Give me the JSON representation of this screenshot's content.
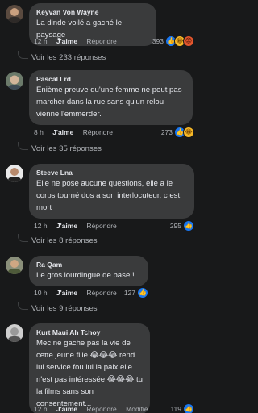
{
  "comments": [
    {
      "author": "Keyvan Von Wayne",
      "text": "La dinde voilé a gaché le paysage",
      "time": "12 h",
      "like": "J'aime",
      "reply": "Répondre",
      "reaction_count": "393",
      "replies": "Voir les 233 réponses"
    },
    {
      "author": "Pascal Lrd",
      "text": "Enième preuve qu'une femme ne peut pas marcher dans la rue sans qu'un relou vienne l'emmerder.",
      "time": "8 h",
      "like": "J'aime",
      "reply": "Répondre",
      "reaction_count": "273",
      "replies": "Voir les 35 réponses"
    },
    {
      "author": "Steeve Lna",
      "text": "Elle ne pose aucune questions, elle a le corps tourné dos a son interlocuteur, c est mort",
      "time": "12 h",
      "like": "J'aime",
      "reply": "Répondre",
      "reaction_count": "295",
      "replies": "Voir les 8 réponses"
    },
    {
      "author": "Ra Qam",
      "text": "Le gros lourdingue de base !",
      "time": "10 h",
      "like": "J'aime",
      "reply": "Répondre",
      "reaction_count": "127",
      "replies": "Voir les 9 réponses"
    },
    {
      "author": "Kurt Maui Ah Tchoy",
      "text": "Mec ne gache pas la vie de cette jeune fille 😂😂😂 rend lui service fou lui la paix elle n'est pas intéressée 😂😂😂 tu la films sans son consentement...",
      "time": "12 h",
      "like": "J'aime",
      "reply": "Répondre",
      "edited": "Modifié",
      "reaction_count": "119"
    }
  ],
  "icons": {
    "like": "👍",
    "haha": "😂",
    "angry": "😡"
  }
}
